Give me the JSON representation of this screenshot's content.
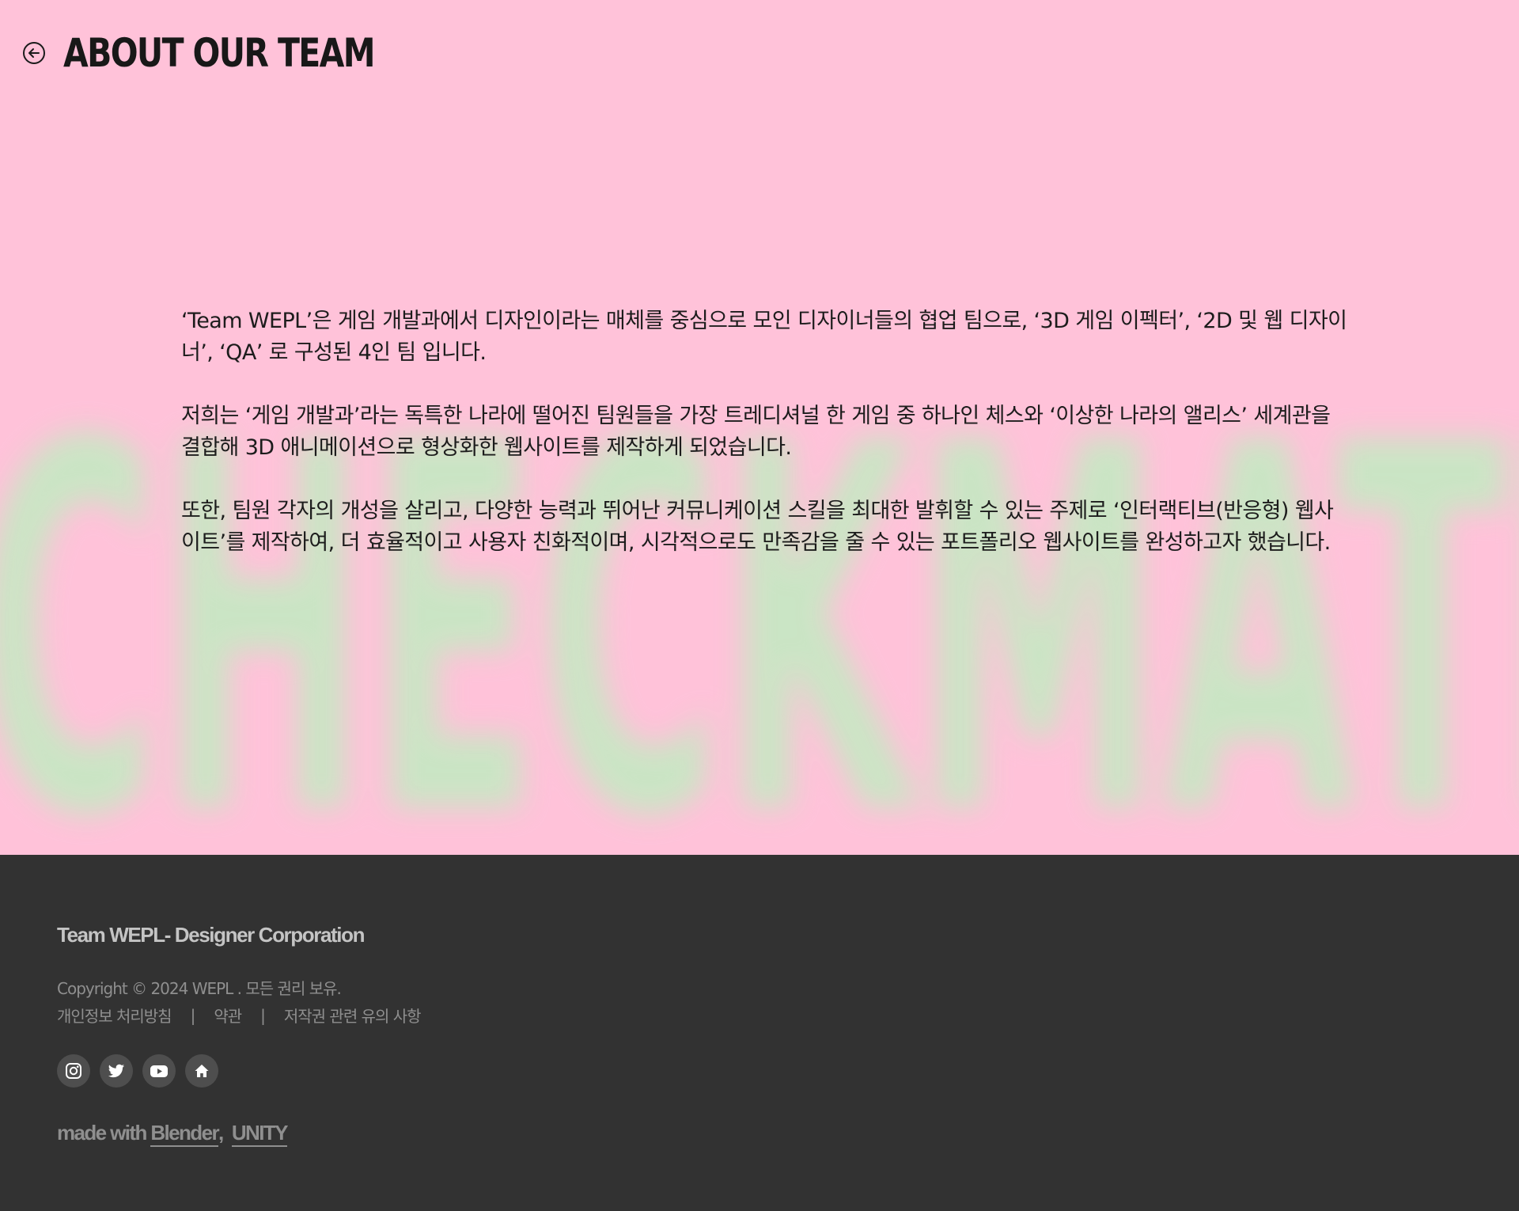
{
  "header": {
    "title": "ABOUT OUR TEAM",
    "back_icon": "arrow-left-circle-icon"
  },
  "background": {
    "word": "CHECKMATE",
    "pink": "#ffc2d9",
    "green": "#c8e7c4"
  },
  "intro": {
    "paragraphs": [
      "‘Team WEPL’은 게임 개발과에서 디자인이라는 매체를 중심으로 모인 디자이너들의 협업 팀으로, ‘3D 게임 이펙터’, ‘2D 및 웹 디자이너’, ‘QA’ 로 구성된 4인 팀 입니다.",
      "저희는 ‘게임 개발과’라는 독특한 나라에 떨어진 팀원들을 가장 트레디셔널 한 게임 중 하나인 체스와 ‘이상한 나라의 앨리스’ 세계관을 결합해 3D 애니메이션으로 형상화한 웹사이트를 제작하게 되었습니다.",
      "또한, 팀원 각자의 개성을 살리고, 다양한 능력과 뛰어난 커뮤니케이션 스킬을 최대한 발휘할 수 있는 주제로 ‘인터랙티브(반응형) 웹사이트’를 제작하여, 더 효율적이고 사용자 친화적이며, 시각적으로도 만족감을 줄 수 있는 포트폴리오 웹사이트를 완성하고자 했습니다."
    ]
  },
  "footer": {
    "brand": "Team WEPL- Designer Corporation",
    "copyright": "Copyright © 2024 WEPL . 모든 권리 보유.",
    "links": [
      "개인정보 처리방침",
      "약관",
      "저작권 관련 유의 사항"
    ],
    "separator": "|",
    "social": [
      "instagram-icon",
      "twitter-icon",
      "youtube-icon",
      "home-icon"
    ],
    "made_with_prefix": "made with",
    "made_with_tools": [
      "Blender",
      "UNITY"
    ],
    "made_with_comma": ",",
    "bg_color": "#323232"
  }
}
